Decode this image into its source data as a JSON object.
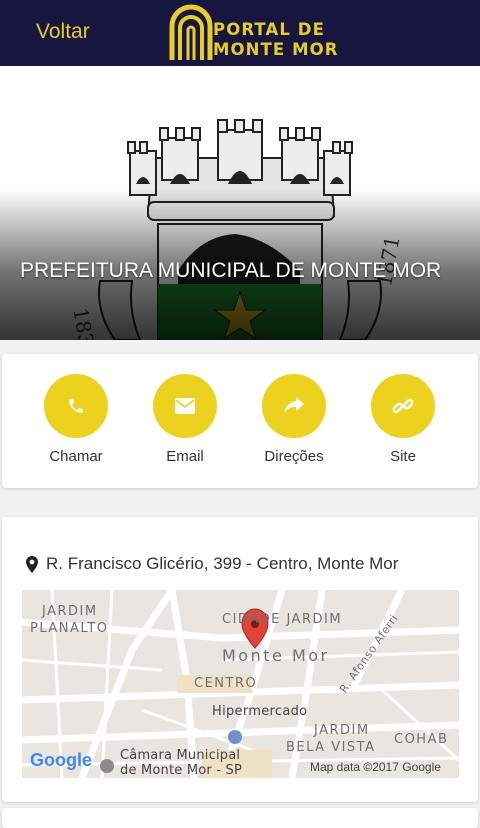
{
  "header": {
    "back_label": "Voltar",
    "logo_line1": "PORTAL DE",
    "logo_line2": "MONTE MOR",
    "accent_color": "#e8cc2a",
    "background_color": "#17163f"
  },
  "hero": {
    "title": "PREFEITURA MUNICIPAL DE MONTE MOR",
    "coat_year_left": "1832",
    "coat_year_right": "1871"
  },
  "actions": [
    {
      "label": "Chamar",
      "icon": "phone-icon"
    },
    {
      "label": "Email",
      "icon": "envelope-icon"
    },
    {
      "label": "Direções",
      "icon": "share-arrow-icon"
    },
    {
      "label": "Site",
      "icon": "link-icon"
    }
  ],
  "address": {
    "icon": "map-marker-icon",
    "text": "R. Francisco Glicério, 399 - Centro, Monte Mor"
  },
  "map": {
    "labels": {
      "jardim_planalto_1": "JARDIM",
      "jardim_planalto_2": "PLANALTO",
      "cidade_jardim": "CIDADE JARDIM",
      "monte_mor": "Monte Mor",
      "centro": "CENTRO",
      "rua_afonso": "R. Afonso Aferri",
      "hipermercado": "Hipermercado",
      "jardim_bela_vista_1": "JARDIM",
      "jardim_bela_vista_2": "BELA VISTA",
      "cohab": "COHAB",
      "camara_1": "Câmara Municipal",
      "camara_2": "de Monte Mor - SP",
      "google": "Google",
      "map_data": "Map data ©2017 Google"
    }
  }
}
